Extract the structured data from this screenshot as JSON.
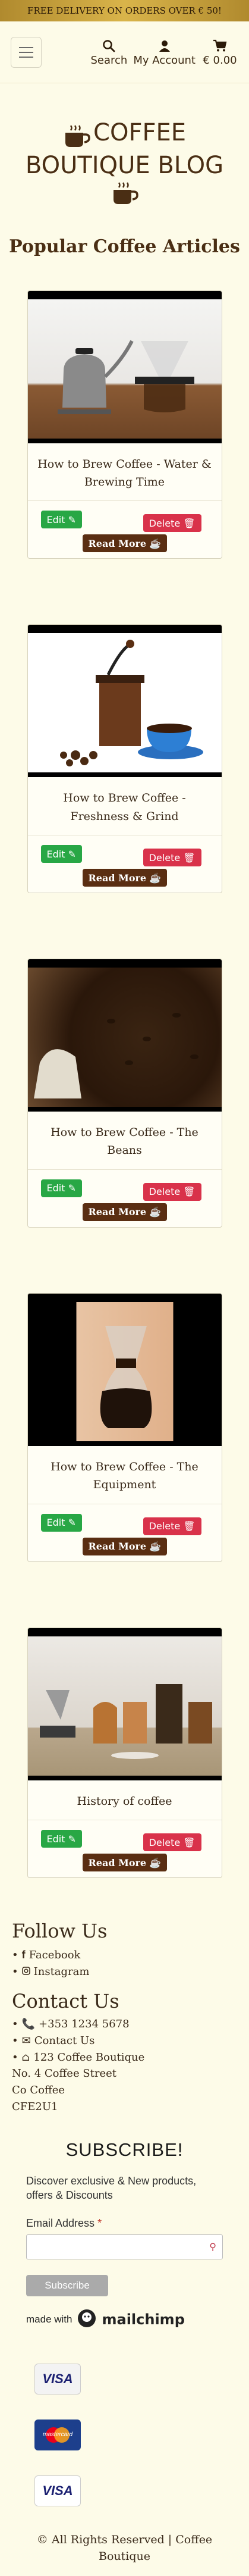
{
  "promo": "FREE DELIVERY ON ORDERS OVER € 50!",
  "nav": {
    "search": "Search",
    "account": "My Account",
    "cart": "€ 0.00"
  },
  "hero": {
    "title": "COFFEE BOUTIQUE BLOG"
  },
  "section_title": "Popular Coffee Articles",
  "articles": [
    {
      "title": "How to Brew Coffee - Water & Brewing Time",
      "image": "kettle-and-pour-over"
    },
    {
      "title": "How to Brew Coffee - Freshness & Grind",
      "image": "grinder-and-cup"
    },
    {
      "title": "How to Brew Coffee - The Beans",
      "image": "coffee-beans"
    },
    {
      "title": "How to Brew Coffee - The Equipment",
      "image": "chemex-pot"
    },
    {
      "title": "History of coffee",
      "image": "vintage-equipment"
    }
  ],
  "buttons": {
    "edit": "Edit",
    "delete": "Delete",
    "read_more": "Read More"
  },
  "footer": {
    "follow_title": "Follow Us",
    "facebook": "Facebook",
    "instagram": "Instagram",
    "contact_title": "Contact Us",
    "phone": "+353 1234 5678",
    "email": "Contact Us",
    "address_1": "123 Coffee Boutique",
    "address_2": "No. 4 Coffee Street",
    "address_3": "Co Coffee",
    "address_4": "CFE2U1"
  },
  "subscribe": {
    "title": "SUBSCRIBE!",
    "text": "Discover exclusive & New products, offers & Discounts",
    "label": "Email Address",
    "required": "*",
    "button": "Subscribe",
    "made_with": "made with",
    "brand": "mailchimp"
  },
  "payments": [
    "VISA",
    "mastercard",
    "VISA"
  ],
  "copyright": "All Rights Reserved | Coffee Boutique",
  "colors": {
    "background": "#fdfbe8",
    "brown": "#4a2e14",
    "edit": "#28a745",
    "delete": "#d9324a",
    "read_more": "#5a2e12"
  }
}
